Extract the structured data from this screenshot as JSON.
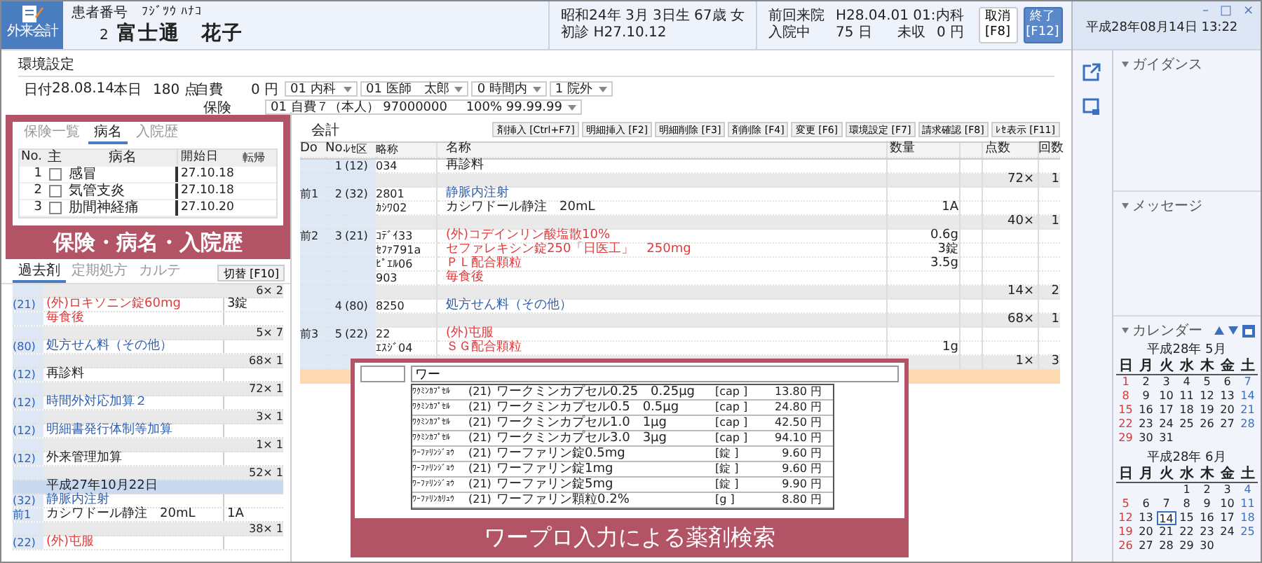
{
  "app_button": {
    "label": "外来会計"
  },
  "patient": {
    "number_label": "患者番号",
    "kana": "ﾌｼﾞﾂｳ ﾊﾅｺ",
    "number": "2",
    "name": "富士通　花子"
  },
  "patient_info": {
    "birth": "昭和24年 3月 3日生 67歳",
    "sex": "女",
    "first_visit": "初診 H27.10.12",
    "last_visit_label": "前回来院",
    "last_visit": "H28.04.01 01:内科",
    "inpatient_label": "入院中",
    "inpatient_days": "75 日",
    "unpaid_label": "未収",
    "unpaid": "0 円"
  },
  "actions": [
    {
      "label": "取消",
      "key": "[F8]",
      "primary": false
    },
    {
      "label": "終了",
      "key": "[F12]",
      "primary": true
    }
  ],
  "clock": "平成28年08月14日 13:22",
  "window_controls": [
    "–",
    "□",
    "×"
  ],
  "settings": {
    "title": "環境設定",
    "date_label": "日付",
    "date": "28.08.14",
    "today_label": "本日",
    "points": "180 点",
    "self_pay_label": "自費",
    "self_pay": "0 円",
    "insurance_label": "保険",
    "selects": [
      "01 内科",
      "01 医師　太郎",
      "0 時間内",
      "1 院外"
    ],
    "insurance": "01 自費７（本人） 97000000",
    "insurance_rate": "100% 99.99.99"
  },
  "disease_panel": {
    "tabs": [
      {
        "label": "保険一覧",
        "selected": false
      },
      {
        "label": "病名",
        "selected": true
      },
      {
        "label": "入院歴",
        "selected": false
      }
    ],
    "columns": [
      "No.",
      "主",
      "病名",
      "開始日",
      "転帰"
    ],
    "rows": [
      {
        "no": "1",
        "main": false,
        "name": "感冒",
        "start": "27.10.18"
      },
      {
        "no": "2",
        "main": false,
        "name": "気管支炎",
        "start": "27.10.18"
      },
      {
        "no": "3",
        "main": false,
        "name": "肋間神経痛",
        "start": "27.10.20"
      }
    ],
    "callout": "保険・病名・入院歴"
  },
  "history_panel": {
    "tabs": [
      {
        "label": "過去剤",
        "selected": true
      },
      {
        "label": "定期処方",
        "selected": false
      },
      {
        "label": "カルテ",
        "selected": false
      }
    ],
    "switch_button": "切替 [F10]",
    "rows": [
      {
        "kind": "total",
        "points": "6×",
        "times": "2"
      },
      {
        "kind": "item",
        "code": "(21)",
        "name": "(外)ロキソニン錠60mg",
        "qty": "3錠",
        "color": "#e03a3a"
      },
      {
        "kind": "item",
        "name": "毎食後",
        "color": "#e03a3a"
      },
      {
        "kind": "total",
        "points": "5×",
        "times": "7"
      },
      {
        "kind": "item",
        "code": "(80)",
        "name": "処方せん料（その他）",
        "color": "#2f5fb0"
      },
      {
        "kind": "total",
        "points": "68×",
        "times": "1"
      },
      {
        "kind": "item",
        "code": "(12)",
        "name": "再診料",
        "color": "#222222"
      },
      {
        "kind": "total",
        "points": "72×",
        "times": "1"
      },
      {
        "kind": "item",
        "code": "(12)",
        "name": "時間外対応加算２",
        "color": "#2f5fb0"
      },
      {
        "kind": "total",
        "points": "3×",
        "times": "1"
      },
      {
        "kind": "item",
        "code": "(12)",
        "name": "明細書発行体制等加算",
        "color": "#2f5fb0"
      },
      {
        "kind": "total",
        "points": "1×",
        "times": "1"
      },
      {
        "kind": "item",
        "code": "(12)",
        "name": "外来管理加算",
        "color": "#222222"
      },
      {
        "kind": "total",
        "points": "52×",
        "times": "1"
      },
      {
        "kind": "date",
        "text": "平成27年10月22日"
      },
      {
        "kind": "item",
        "code": "(32)",
        "name": "静脈内注射",
        "color": "#2f5fb0"
      },
      {
        "kind": "item",
        "code": "前1",
        "name": "カシワドール静注　20mL",
        "qty": "1A",
        "color": "#222222"
      },
      {
        "kind": "total",
        "points": "38×",
        "times": "1"
      },
      {
        "kind": "item",
        "code": "(22)",
        "name": "(外)屯服",
        "color": "#e03a3a"
      }
    ]
  },
  "accounting": {
    "title": "会計",
    "buttons": [
      "剤挿入 [Ctrl+F7]",
      "明細挿入 [F2]",
      "明細削除 [F3]",
      "剤削除 [F4]",
      "変更 [F6]",
      "環境設定 [F7]",
      "請求確認 [F8]",
      "ﾚｾ表示 [F11]"
    ],
    "columns": [
      "Do",
      "No.",
      "ﾚｾ区",
      "略称",
      "名称",
      "数量",
      "点数",
      "回数"
    ],
    "groups": [
      {
        "no": "1",
        "ku": "(12)",
        "lines": [
          {
            "abbr": "034",
            "name": "再診料",
            "color": "#222222"
          }
        ],
        "points": "72×",
        "times": "1"
      },
      {
        "do": "前1",
        "no": "2",
        "ku": "(32)",
        "lines": [
          {
            "abbr": "2801",
            "name": "静脈内注射",
            "color": "#2f5fb0"
          },
          {
            "abbr": "ｶｼﾜ02",
            "name": "カシワドール静注　20mL",
            "qty": "1A",
            "color": "#222222"
          }
        ],
        "points": "40×",
        "times": "1"
      },
      {
        "do": "前2",
        "no": "3",
        "ku": "(21)",
        "lines": [
          {
            "abbr": "ｺﾃﾞｲ33",
            "name": "(外)コデインリン酸塩散10%",
            "qty": "0.6g",
            "color": "#e03a3a"
          },
          {
            "abbr": "ｾﾌｧ791a",
            "name": "セファレキシン錠250「日医工」　250mg",
            "qty": "3錠",
            "color": "#e03a3a"
          },
          {
            "abbr": "ﾋﾟｴﾙ06",
            "name": "ＰＬ配合顆粒",
            "qty": "3.5g",
            "color": "#e03a3a"
          },
          {
            "abbr": "903",
            "name": "毎食後",
            "color": "#e03a3a"
          }
        ],
        "points": "14×",
        "times": "2"
      },
      {
        "no": "4",
        "ku": "(80)",
        "lines": [
          {
            "abbr": "8250",
            "name": "処方せん料（その他）",
            "color": "#2f5fb0"
          }
        ],
        "points": "68×",
        "times": "1"
      },
      {
        "do": "前3",
        "no": "5",
        "ku": "(22)",
        "lines": [
          {
            "abbr": "22",
            "name": "(外)屯服",
            "color": "#e03a3a"
          },
          {
            "abbr": "ｴｽｼﾞ04",
            "name": "ＳＧ配合顆粒",
            "qty": "1g",
            "color": "#e03a3a"
          }
        ],
        "points": "1×",
        "times": "3"
      }
    ]
  },
  "search": {
    "value": "ワー",
    "callout": "ワープロ入力による薬剤検索",
    "results": [
      {
        "abbr": "ﾜｸﾐﾝｶﾌﾟｾﾙ",
        "ku": "(21)",
        "name": "ワークミンカプセル0.25　0.25μg",
        "unit": "[cap ]",
        "price": "13.80 円"
      },
      {
        "abbr": "ﾜｸﾐﾝｶﾌﾟｾﾙ",
        "ku": "(21)",
        "name": "ワークミンカプセル0.5　0.5μg",
        "unit": "[cap ]",
        "price": "24.80 円"
      },
      {
        "abbr": "ﾜｸﾐﾝｶﾌﾟｾﾙ",
        "ku": "(21)",
        "name": "ワークミンカプセル1.0　1μg",
        "unit": "[cap ]",
        "price": "42.50 円"
      },
      {
        "abbr": "ﾜｸﾐﾝｶﾌﾟｾﾙ",
        "ku": "(21)",
        "name": "ワークミンカプセル3.0　3μg",
        "unit": "[cap ]",
        "price": "94.10 円"
      },
      {
        "abbr": "ﾜｰﾌｧﾘﾝｼﾞｮｳ",
        "ku": "(21)",
        "name": "ワーファリン錠0.5mg",
        "unit": "[錠 ]",
        "price": "9.60 円"
      },
      {
        "abbr": "ﾜｰﾌｧﾘﾝｼﾞｮｳ",
        "ku": "(21)",
        "name": "ワーファリン錠1mg",
        "unit": "[錠 ]",
        "price": "9.60 円"
      },
      {
        "abbr": "ﾜｰﾌｧﾘﾝｼﾞｮｳ",
        "ku": "(21)",
        "name": "ワーファリン錠5mg",
        "unit": "[錠 ]",
        "price": "9.90 円"
      },
      {
        "abbr": "ﾜｰﾌｧﾘﾝｶﾘｭｳ",
        "ku": "(21)",
        "name": "ワーファリン顆粒0.2%",
        "unit": "[g ]",
        "price": "8.80 円"
      }
    ]
  },
  "sidebar": {
    "sections": [
      "ガイダンス",
      "メッセージ",
      "カレンダー"
    ]
  },
  "calendar": {
    "months": [
      {
        "title": "平成28年 5月",
        "weekdays": [
          "日",
          "月",
          "火",
          "水",
          "木",
          "金",
          "土"
        ],
        "weeks": [
          [
            {
              "d": "1",
              "selected": false
            },
            {
              "d": "2",
              "selected": false
            },
            {
              "d": "3",
              "selected": false
            },
            {
              "d": "4",
              "selected": false
            },
            {
              "d": "5",
              "selected": false
            },
            {
              "d": "6",
              "selected": false
            },
            {
              "d": "7",
              "selected": false
            }
          ],
          [
            {
              "d": "8",
              "selected": false
            },
            {
              "d": "9",
              "selected": false
            },
            {
              "d": "10",
              "selected": false
            },
            {
              "d": "11",
              "selected": false
            },
            {
              "d": "12",
              "selected": false
            },
            {
              "d": "13",
              "selected": false
            },
            {
              "d": "14",
              "selected": false
            }
          ],
          [
            {
              "d": "15",
              "selected": false
            },
            {
              "d": "16",
              "selected": false
            },
            {
              "d": "17",
              "selected": false
            },
            {
              "d": "18",
              "selected": false
            },
            {
              "d": "19",
              "selected": false
            },
            {
              "d": "20",
              "selected": false
            },
            {
              "d": "21",
              "selected": false
            }
          ],
          [
            {
              "d": "22",
              "selected": false
            },
            {
              "d": "23",
              "selected": false
            },
            {
              "d": "24",
              "selected": false
            },
            {
              "d": "25",
              "selected": false
            },
            {
              "d": "26",
              "selected": false
            },
            {
              "d": "27",
              "selected": false
            },
            {
              "d": "28",
              "selected": false
            }
          ],
          [
            {
              "d": "29",
              "selected": false
            },
            {
              "d": "30",
              "selected": false
            },
            {
              "d": "31",
              "selected": false
            }
          ]
        ]
      },
      {
        "title": "平成28年 6月",
        "weekdays": [
          "日",
          "月",
          "火",
          "水",
          "木",
          "金",
          "土"
        ],
        "weeks": [
          [
            {
              "d": "1",
              "selected": false
            },
            {
              "d": "2",
              "selected": false
            },
            {
              "d": "3",
              "selected": false
            },
            {
              "d": "4",
              "selected": false
            }
          ],
          [
            {
              "d": "5",
              "selected": false
            },
            {
              "d": "6",
              "selected": false
            },
            {
              "d": "7",
              "selected": false
            },
            {
              "d": "8",
              "selected": false
            },
            {
              "d": "9",
              "selected": false
            },
            {
              "d": "10",
              "selected": false
            },
            {
              "d": "11",
              "selected": false
            }
          ],
          [
            {
              "d": "12",
              "selected": false
            },
            {
              "d": "13",
              "selected": false
            },
            {
              "d": "14",
              "selected": true
            },
            {
              "d": "15",
              "selected": false
            },
            {
              "d": "16",
              "selected": false
            },
            {
              "d": "17",
              "selected": false
            },
            {
              "d": "18",
              "selected": false
            }
          ],
          [
            {
              "d": "19",
              "selected": false
            },
            {
              "d": "20",
              "selected": false
            },
            {
              "d": "21",
              "selected": false
            },
            {
              "d": "22",
              "selected": false
            },
            {
              "d": "23",
              "selected": false
            },
            {
              "d": "24",
              "selected": false
            },
            {
              "d": "25",
              "selected": false
            }
          ],
          [
            {
              "d": "26",
              "selected": false
            },
            {
              "d": "27",
              "selected": false
            },
            {
              "d": "28",
              "selected": false
            },
            {
              "d": "29",
              "selected": false
            },
            {
              "d": "30",
              "selected": false
            }
          ]
        ]
      }
    ]
  }
}
